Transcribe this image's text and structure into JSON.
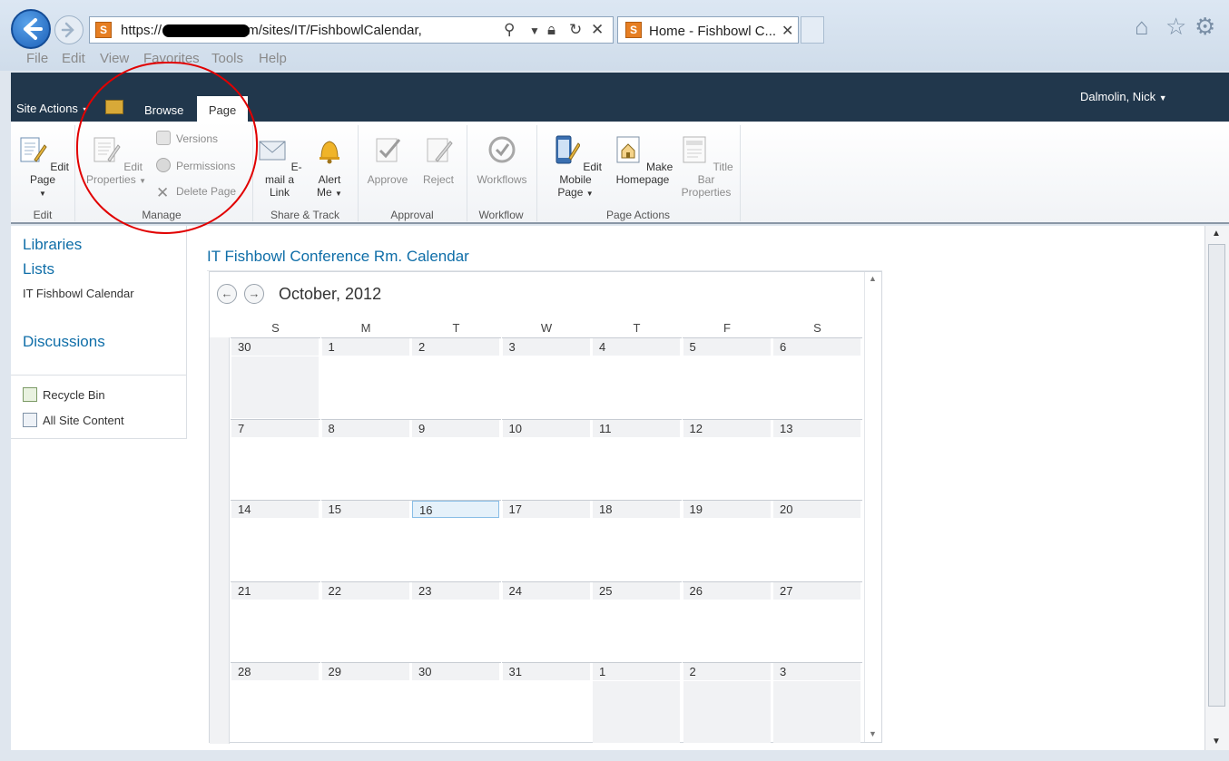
{
  "browser": {
    "url": "https://                sharepoint.com/sites/IT/FishbowlCalendar,",
    "tab_title": "Home - Fishbowl C...",
    "favicon_letter": "S",
    "menu": [
      "File",
      "Edit",
      "View",
      "Favorites",
      "Tools",
      "Help"
    ]
  },
  "sharepoint": {
    "site_actions": "Site Actions",
    "tabs": [
      "Browse",
      "Page"
    ],
    "user": "Dalmolin, Nick"
  },
  "ribbon": {
    "edit": {
      "edit_page": "Edit Page",
      "label": "Edit"
    },
    "manage": {
      "edit_properties_1": "Edit",
      "edit_properties_2": "Properties",
      "versions": "Versions",
      "permissions": "Permissions",
      "delete_page": "Delete Page",
      "label": "Manage"
    },
    "share": {
      "email_1": "E-mail a",
      "email_2": "Link",
      "alert_1": "Alert",
      "alert_2": "Me",
      "label": "Share & Track"
    },
    "approval": {
      "approve": "Approve",
      "reject": "Reject",
      "label": "Approval"
    },
    "workflow": {
      "workflows": "Workflows",
      "label": "Workflow"
    },
    "page_actions": {
      "mobile_1": "Edit Mobile",
      "mobile_2": "Page",
      "home_1": "Make",
      "home_2": "Homepage",
      "title_1": "Title Bar",
      "title_2": "Properties",
      "label": "Page Actions"
    }
  },
  "left_nav": {
    "libraries": "Libraries",
    "lists": "Lists",
    "list_item": "IT Fishbowl Calendar",
    "discussions": "Discussions",
    "recycle_bin": "Recycle Bin",
    "all_site_content": "All Site Content"
  },
  "calendar": {
    "title": "IT Fishbowl Conference Rm. Calendar",
    "month": "October, 2012",
    "days": [
      "S",
      "M",
      "T",
      "W",
      "T",
      "F",
      "S"
    ],
    "today": "16",
    "weeks": [
      [
        "30",
        "1",
        "2",
        "3",
        "4",
        "5",
        "6"
      ],
      [
        "7",
        "8",
        "9",
        "10",
        "11",
        "12",
        "13"
      ],
      [
        "14",
        "15",
        "16",
        "17",
        "18",
        "19",
        "20"
      ],
      [
        "21",
        "22",
        "23",
        "24",
        "25",
        "26",
        "27"
      ],
      [
        "28",
        "29",
        "30",
        "31",
        "1",
        "2",
        "3"
      ]
    ]
  }
}
